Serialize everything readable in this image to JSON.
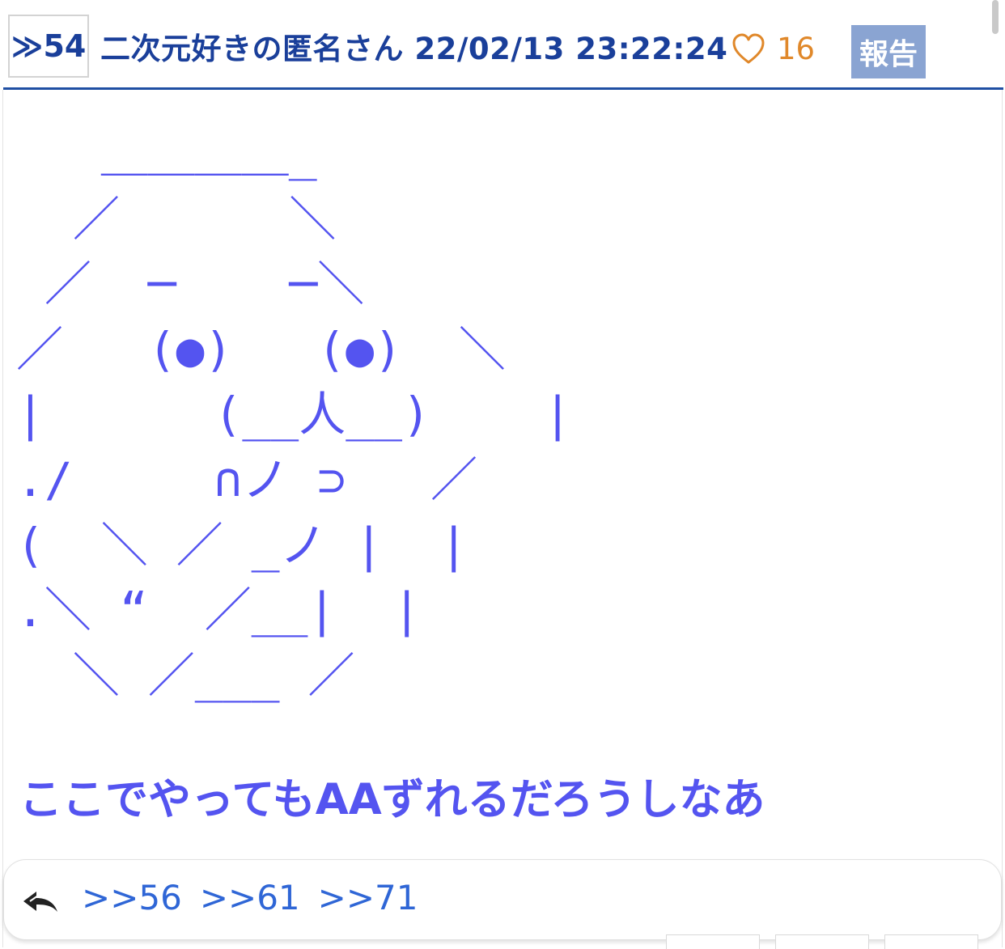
{
  "post": {
    "number_label": "≫54",
    "author_date": "二次元好きの匿名さん 22/02/13 23:22:24",
    "likes": "16",
    "report_label": "報告",
    "ascii_art": "   ＿＿＿＿_\n  ／      ＼\n ／  ─    ─＼\n／   (●)   (●)  ＼\n|      (__人__)    |\n./     ∩ノ ⊃   ／\n(  ＼ ／ _ノ |  |\n.＼ “  ／__|  |\n  ＼ ／___ ／",
    "comment": "ここでやってもAAずれるだろうしなあ"
  },
  "footer": {
    "replies": [
      ">>56",
      ">>61",
      ">>71"
    ]
  },
  "colors": {
    "header_text": "#1a3f9a",
    "accent_text": "#5454f0",
    "like": "#e0882a",
    "report_bg": "#8aa4d2",
    "link": "#2f66d6",
    "divider": "#1f4fa3"
  }
}
